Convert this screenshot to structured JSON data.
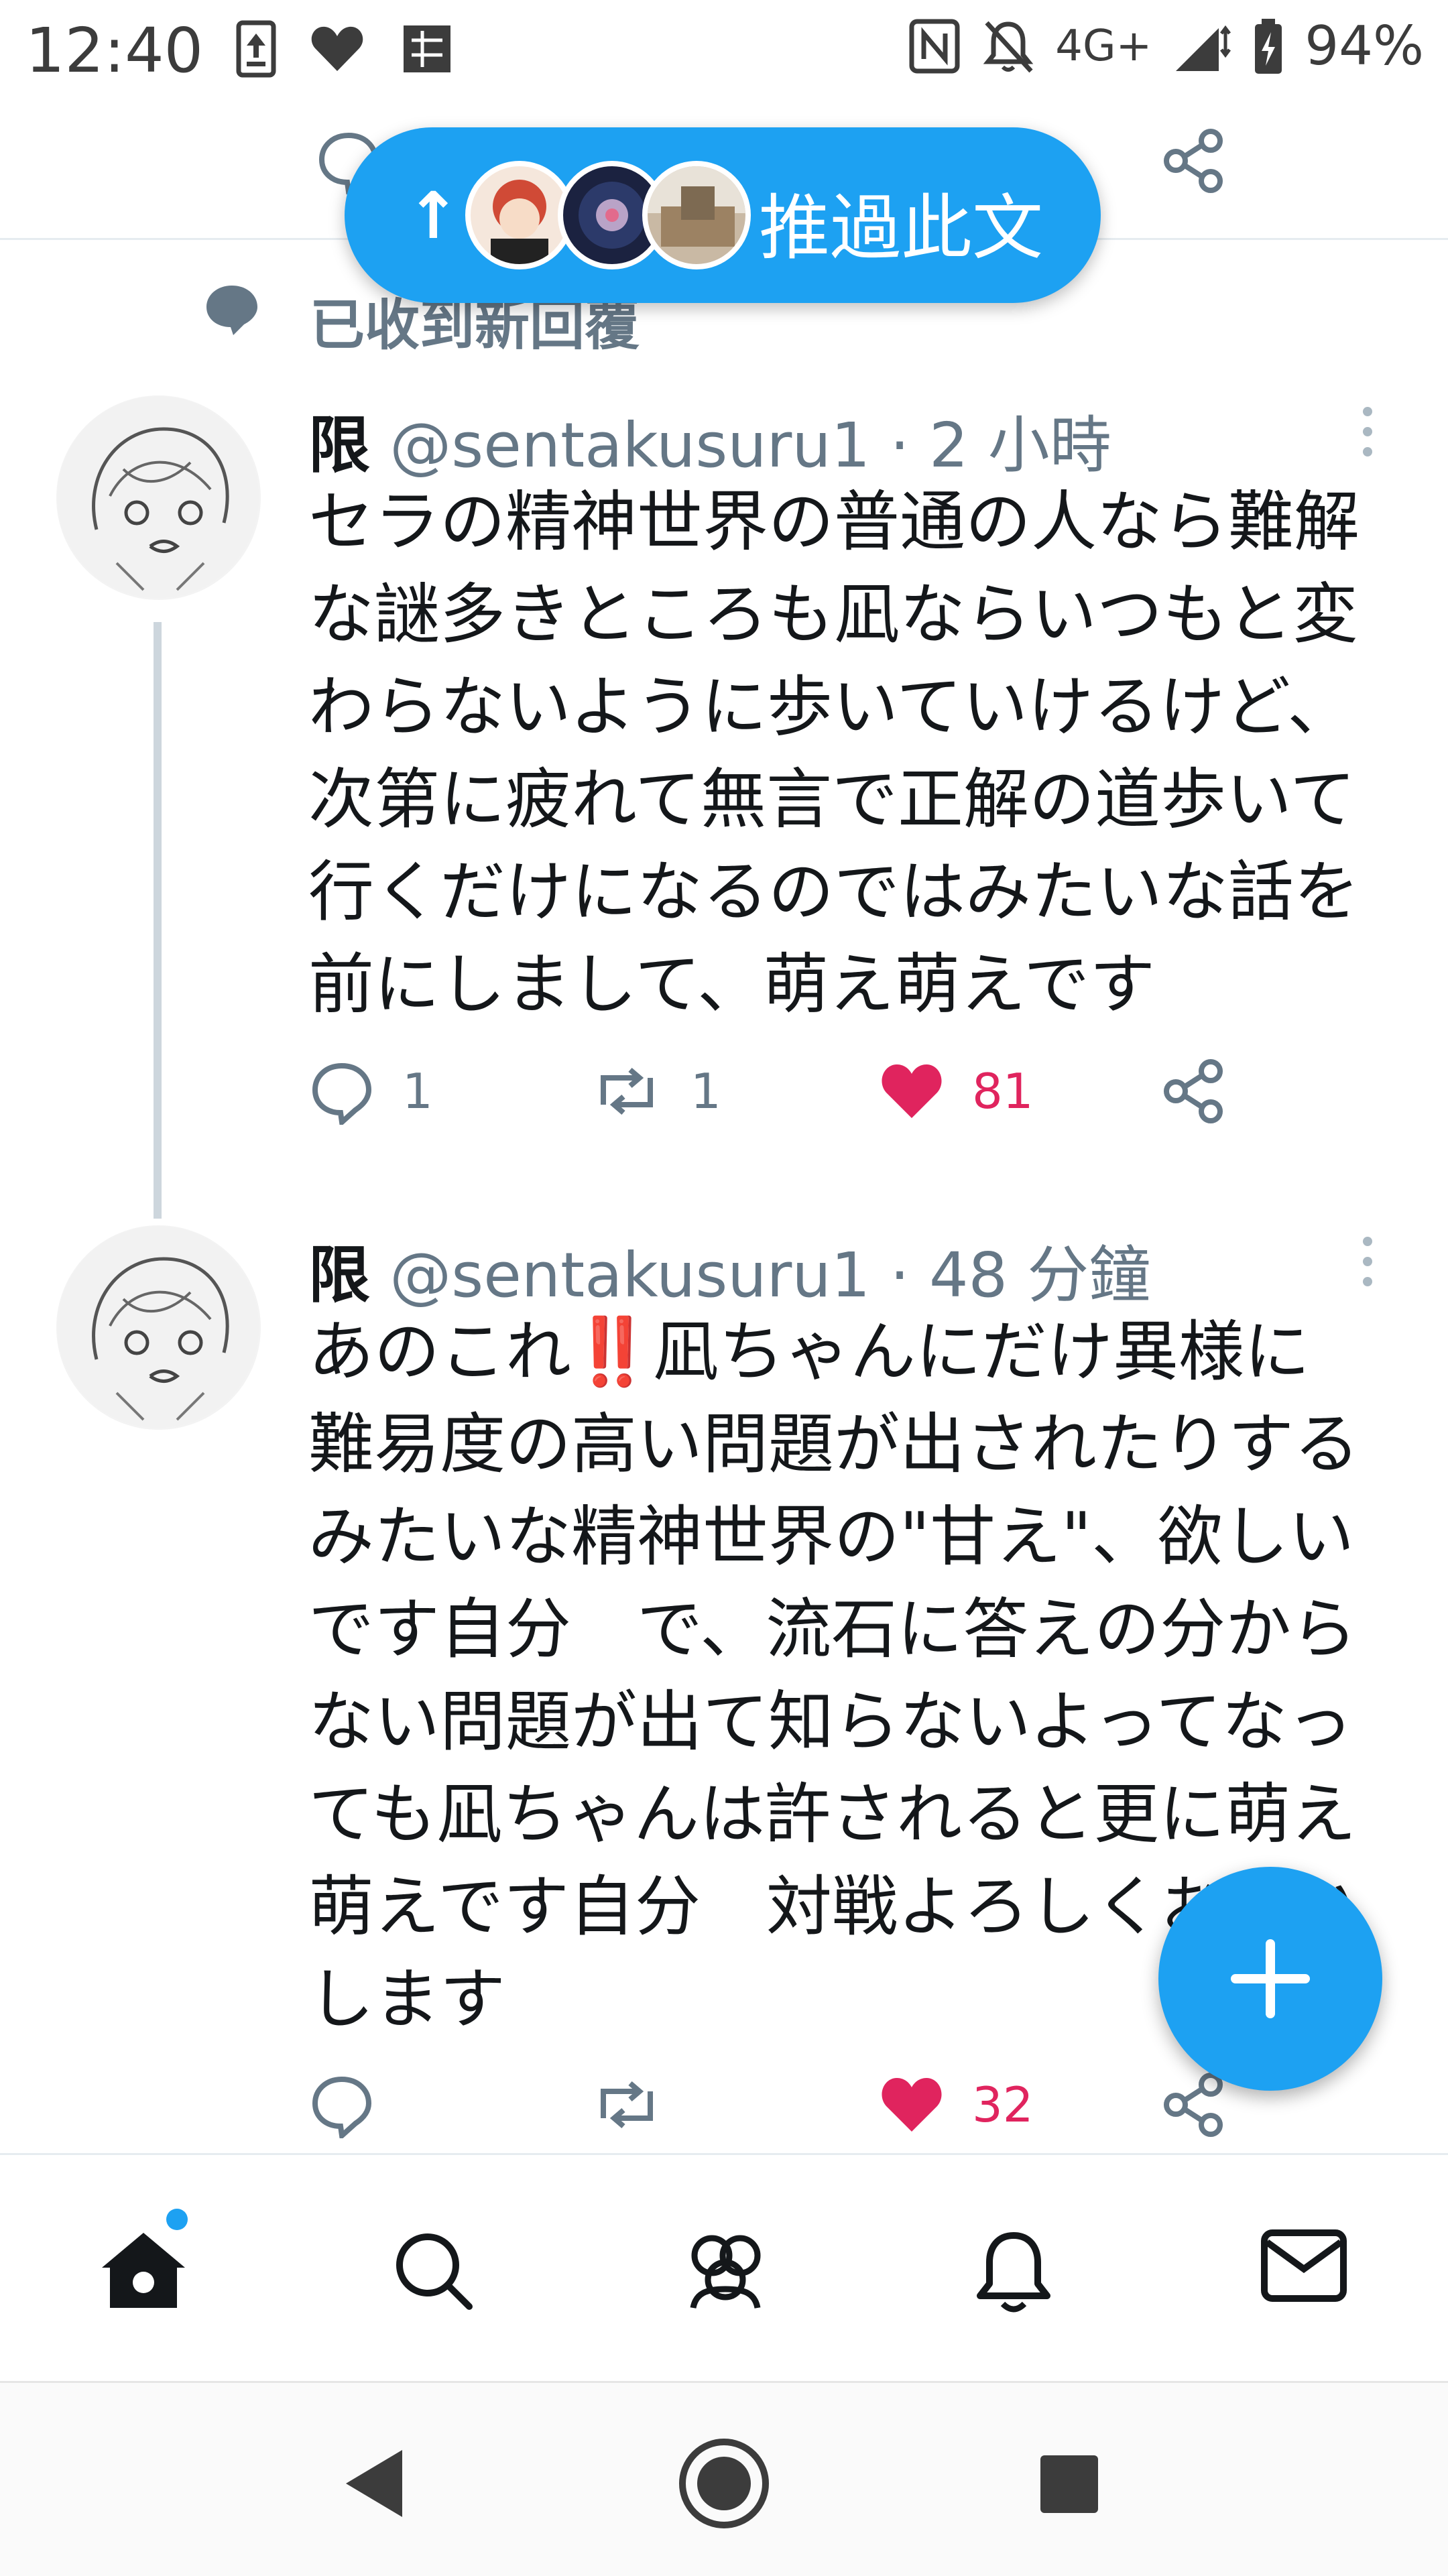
{
  "status_bar": {
    "time": "12:40",
    "network": "4G+",
    "battery": "94%"
  },
  "pill": {
    "text": "推過此文",
    "arrow": "↑"
  },
  "new_replies_label": "已收到新回覆",
  "tweets": [
    {
      "name": "限",
      "handle": "@sentakusuru1",
      "time": "· 2 小時",
      "lines": [
        "セラの精神世界の普通の人なら難解",
        "な謎多きところも凪ならいつもと変",
        "わらないように歩いていけるけど、",
        "次第に疲れて無言で正解の道歩いて",
        "行くだけになるのではみたいな話を",
        "前にしまして、萌え萌えです"
      ],
      "reply_count": "1",
      "retweet_count": "1",
      "like_count": "81"
    },
    {
      "name": "限",
      "handle": "@sentakusuru1",
      "time": "· 48 分鐘",
      "lines": [
        "あのこれ‼️凪ちゃんにだけ異様に",
        "難易度の高い問題が出されたりする",
        "みたいな精神世界の\"甘え\"、欲しい",
        "です自分　で、流石に答えの分から",
        "ない問題が出て知らないよってなっ",
        "ても凪ちゃんは許されると更に萌え",
        "萌えです自分　対戦よろしくお願い",
        "します"
      ],
      "reply_count": "",
      "retweet_count": "",
      "like_count": "32"
    }
  ],
  "colors": {
    "accent": "#1da1f2",
    "like": "#e0245e",
    "secondary_text": "#657786"
  },
  "bottom_nav": [
    "home-icon",
    "search-icon",
    "communities-icon",
    "notifications-icon",
    "messages-icon"
  ]
}
